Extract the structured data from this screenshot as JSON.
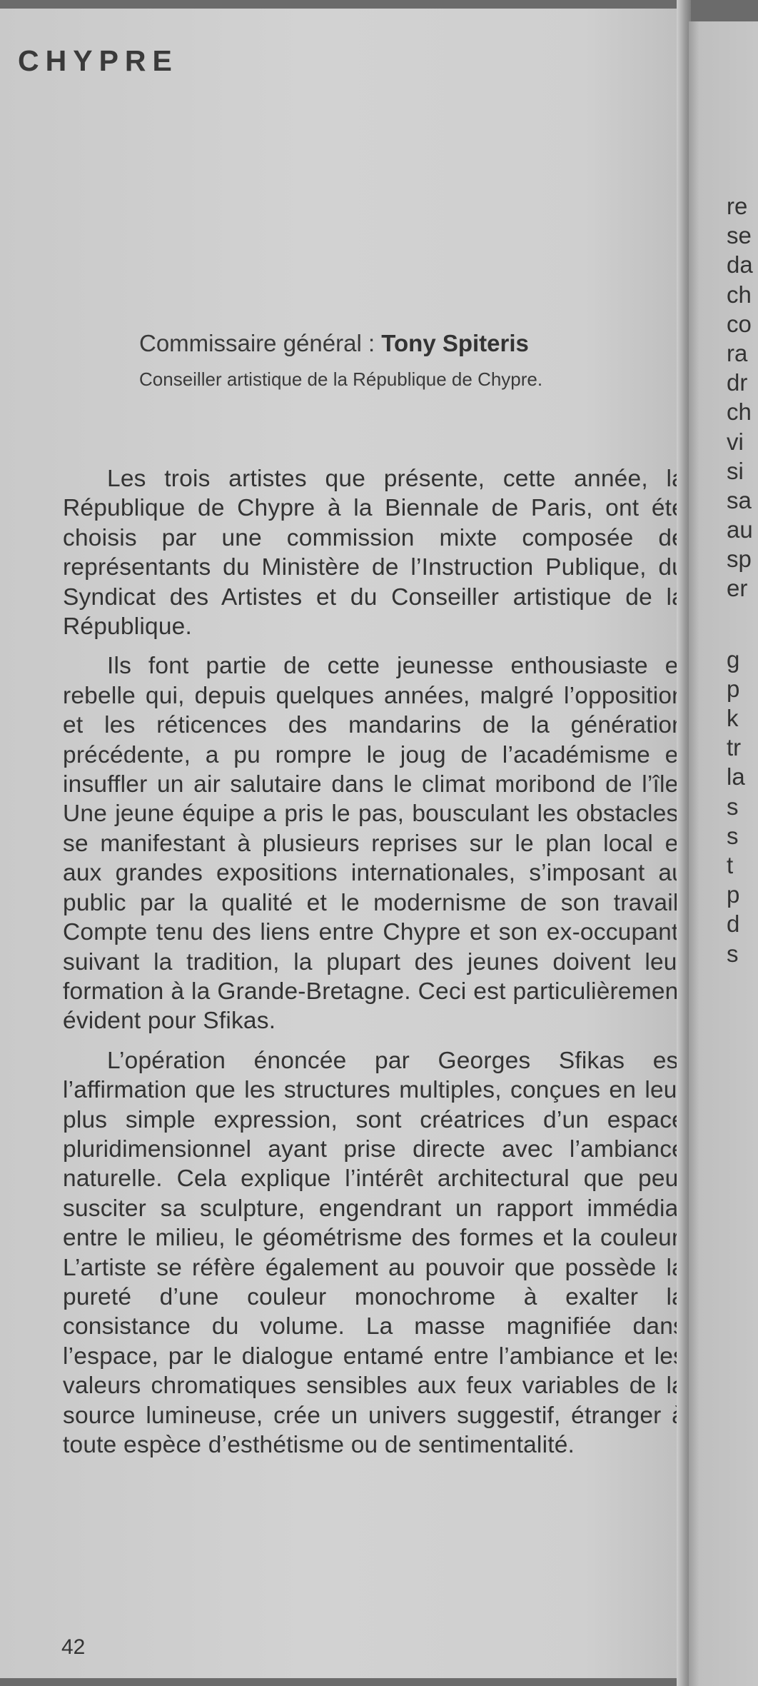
{
  "header": "CHYPRE",
  "commissioner": {
    "label": "Commissaire général :",
    "name": "Tony Spiteris",
    "role": "Conseiller artistique de la République de Chypre."
  },
  "paragraphs": [
    "Les trois artistes que présente, cette année, la République de Chypre à la Biennale de Paris, ont été choisis par une commission mixte composée de représentants du Ministère de l’Instruction Publique, du Syndicat des Artistes et du Conseiller artistique de la République.",
    "Ils font partie de cette jeunesse enthousiaste et rebelle qui, depuis quelques années, malgré l’opposition et les réticences des mandarins de la génération précédente, a pu rompre le joug de l’académisme et insuffler un air salutaire dans le climat moribond de l’île. Une jeune équipe a pris le pas, bousculant les obstacles, se manifestant à plusieurs reprises sur le plan local et aux grandes expositions internationales, s’imposant au public par la qualité et le modernisme de son travail. Compte tenu des liens entre Chypre et son ex-occupant, suivant la tradition, la plupart des jeunes doivent leur formation à la Grande-Bretagne. Ceci est particulièrement évident pour Sfikas.",
    "L’opération énoncée par Georges Sfikas est l’affirmation que les structures multiples, conçues en leur plus simple expression, sont créatrices d’un espace pluridimensionnel ayant prise directe avec l’ambiance naturelle. Cela explique l’intérêt architectural que peut susciter sa sculpture, engendrant un rapport immédiat entre le milieu, le géométrisme des formes et la couleur. L’artiste se réfère également au pouvoir que possède la pureté d’une couleur monochrome à exalter la consistance du volume. La masse magnifiée dans l’espace, par le dialogue entamé entre l’ambiance et les valeurs chromatiques sensibles aux feux variables de la source lumineuse, crée un univers suggestif, étranger à toute espèce d’esthétisme ou de sentimentalité."
  ],
  "page_number": "42",
  "facing_page_fragments": {
    "group1": [
      "re",
      "se",
      "da",
      "ch",
      "co",
      "ra",
      "dr",
      "ch",
      "vi",
      "si",
      "sa",
      "au",
      "sp",
      "er"
    ],
    "group2": [
      "g",
      "p",
      "k",
      "tr",
      "la",
      "s",
      "s",
      "t",
      "p",
      "d",
      "s"
    ]
  }
}
